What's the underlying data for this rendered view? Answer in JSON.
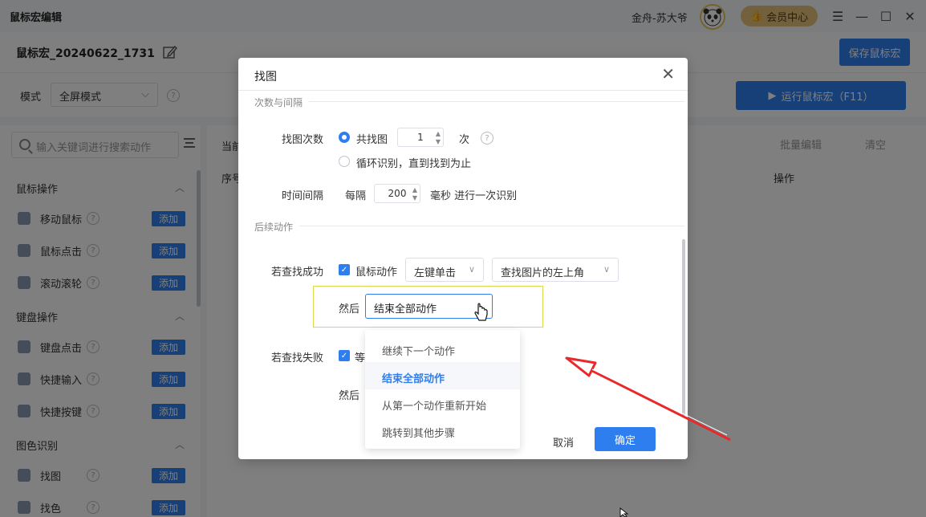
{
  "titlebar": {
    "app_title": "鼠标宏编辑",
    "user_name": "金舟-苏大爷",
    "member_label": "会员中心"
  },
  "toolbar": {
    "macro_name": "鼠标宏_20240622_1731",
    "save_label": "保存鼠标宏"
  },
  "modebar": {
    "mode_label": "模式",
    "mode_value": "全屏模式",
    "run_label": "运行鼠标宏（F11）"
  },
  "sidebar": {
    "search_placeholder": "输入关键词进行搜索动作",
    "sections": [
      {
        "title": "鼠标操作",
        "items": [
          "移动鼠标",
          "鼠标点击",
          "滚动滚轮"
        ]
      },
      {
        "title": "键盘操作",
        "items": [
          "键盘点击",
          "快捷输入",
          "快捷按键"
        ]
      },
      {
        "title": "图色识别",
        "items": [
          "找图",
          "找色"
        ]
      }
    ],
    "add_label": "添加"
  },
  "main": {
    "tab_label": "当前",
    "col_seq": "序号",
    "col_ops": "操作",
    "batch_edit": "批量编辑",
    "clear": "清空"
  },
  "dialog": {
    "title": "找图",
    "section_count": "次数与间隔",
    "find_count_label": "找图次数",
    "radio_total": "共找图",
    "count_value": "1",
    "count_unit": "次",
    "radio_loop": "循环识别，直到找到为止",
    "interval_label": "时间间隔",
    "interval_prefix": "每隔",
    "interval_value": "200",
    "interval_suffix": "毫秒 进行一次识别",
    "section_follow": "后续动作",
    "success_label": "若查找成功",
    "mouse_action": "鼠标动作",
    "click_type": "左键单击",
    "position": "查找图片的左上角",
    "then_label": "然后",
    "then_value": "结束全部动作",
    "fail_label": "若查找失败",
    "fail_check_text": "等",
    "fail_then_label": "然后",
    "cancel_label": "取消",
    "ok_label": "确定"
  },
  "dropdown": {
    "options": [
      "继续下一个动作",
      "结束全部动作",
      "从第一个动作重新开始",
      "跳转到其他步骤"
    ],
    "selected_index": 1
  },
  "colors": {
    "accent": "#2f7ef0",
    "arrow": "#e8282a",
    "member_gold": "#e6c27a"
  }
}
